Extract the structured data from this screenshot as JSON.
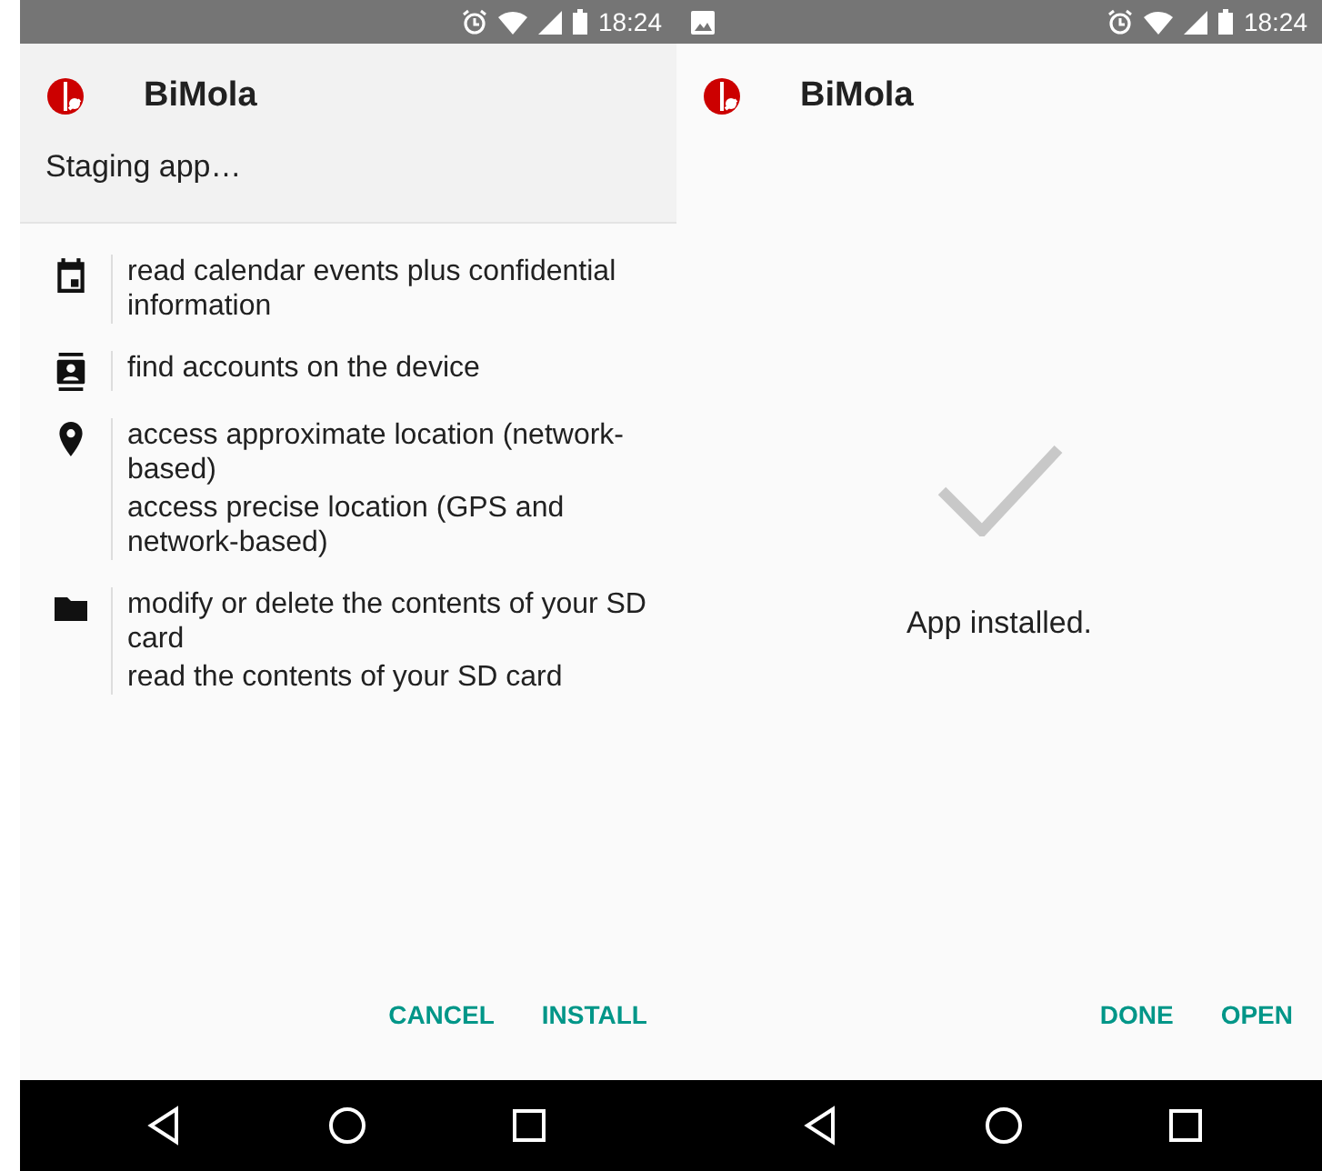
{
  "screens": [
    {
      "kind": "permissions",
      "status_bar": {
        "notification": false,
        "time": "18:24"
      },
      "app_name": "BiMola",
      "subtitle": "Staging app…",
      "permission_groups": [
        {
          "kind": "calendar",
          "items": [
            "read calendar events plus confidential information"
          ]
        },
        {
          "kind": "contacts",
          "items": [
            "find accounts on the device"
          ]
        },
        {
          "kind": "location",
          "items": [
            "access approximate location (network-based)",
            "access precise location (GPS and network-based)"
          ]
        },
        {
          "kind": "storage",
          "items": [
            "modify or delete the contents of your SD card",
            "read the contents of your SD card"
          ]
        }
      ],
      "buttons": [
        "CANCEL",
        "INSTALL"
      ]
    },
    {
      "kind": "installed",
      "status_bar": {
        "notification": true,
        "time": "18:24"
      },
      "app_name": "BiMola",
      "message": "App installed.",
      "buttons": [
        "DONE",
        "OPEN"
      ]
    }
  ]
}
